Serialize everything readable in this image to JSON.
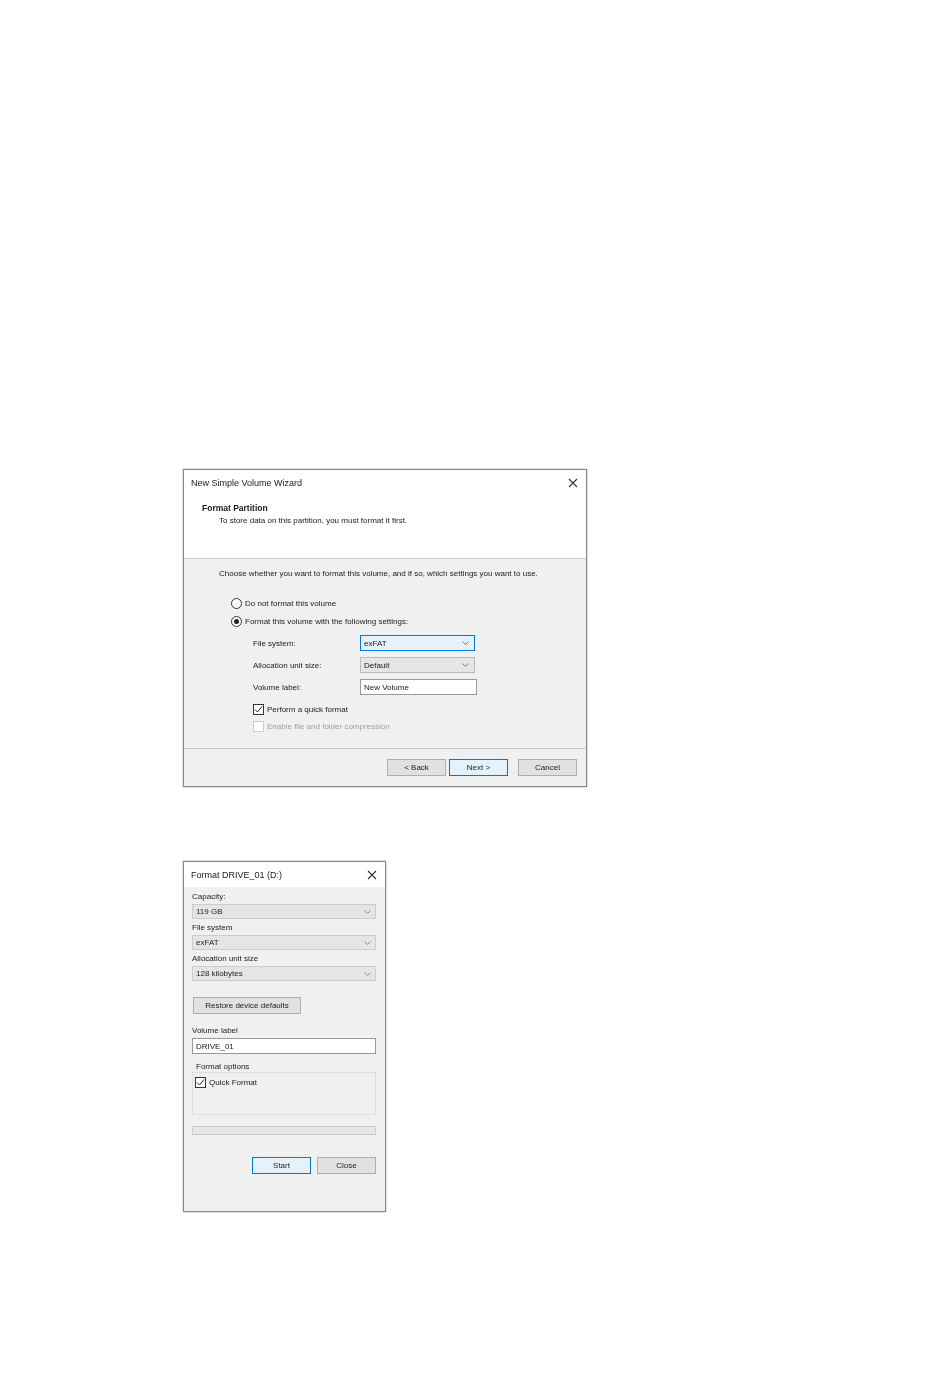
{
  "wizard": {
    "title": "New Simple Volume Wizard",
    "heading": "Format Partition",
    "subheading": "To store data on this partition, you must format it first.",
    "intro": "Choose whether you want to format this volume, and if so, which settings you want to use.",
    "options": [
      {
        "label": "Do not format this volume",
        "selected": false
      },
      {
        "label": "Format this volume with the following settings:",
        "selected": true
      }
    ],
    "fields": [
      {
        "kind": "dropdown",
        "label": "File system:",
        "value": "exFAT",
        "focused": true
      },
      {
        "kind": "dropdown",
        "label": "Allocation unit size:",
        "value": "Default",
        "focused": false
      },
      {
        "kind": "text",
        "label": "Volume label:",
        "value": "New Volume",
        "focused": false
      }
    ],
    "checkboxes": [
      {
        "label": "Perform a quick format",
        "checked": true,
        "disabled": false
      },
      {
        "label": "Enable file and folder compression",
        "checked": false,
        "disabled": true
      }
    ],
    "buttons": [
      {
        "label": "< Back",
        "default": false
      },
      {
        "label": "Next >",
        "default": true
      },
      {
        "label": "Cancel",
        "default": false
      }
    ]
  },
  "format_dialog": {
    "title": "Format DRIVE_01 (D:)",
    "dropdowns": [
      {
        "label": "Capacity:",
        "value": "119 GB"
      },
      {
        "label": "File system",
        "value": "exFAT"
      },
      {
        "label": "Allocation unit size",
        "value": "128 kilobytes"
      }
    ],
    "restore_button": "Restore device defaults",
    "volume_label": {
      "label": "Volume label",
      "value": "DRIVE_01"
    },
    "format_options": {
      "title": "Format options",
      "checkboxes": [
        {
          "label": "Quick Format",
          "checked": true
        }
      ]
    },
    "progress": {
      "level": 0
    },
    "buttons": [
      {
        "label": "Start",
        "default": true
      },
      {
        "label": "Close",
        "default": false
      }
    ]
  }
}
